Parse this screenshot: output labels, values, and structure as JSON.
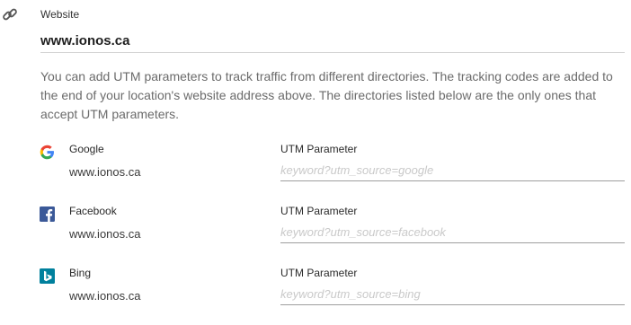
{
  "website": {
    "label": "Website",
    "value": "www.ionos.ca",
    "icon": "link-icon"
  },
  "help_text": "You can add UTM parameters to track traffic from different directories. The tracking codes are added to the end of your location's website address above. The directories listed below are the only ones that accept UTM parameters.",
  "directories": [
    {
      "name": "Google",
      "icon": "google-icon",
      "url": "www.ionos.ca",
      "utm_label": "UTM Parameter",
      "utm_value": "",
      "utm_placeholder": "keyword?utm_source=google"
    },
    {
      "name": "Facebook",
      "icon": "facebook-icon",
      "url": "www.ionos.ca",
      "utm_label": "UTM Parameter",
      "utm_value": "",
      "utm_placeholder": "keyword?utm_source=facebook"
    },
    {
      "name": "Bing",
      "icon": "bing-icon",
      "url": "www.ionos.ca",
      "utm_label": "UTM Parameter",
      "utm_value": "",
      "utm_placeholder": "keyword?utm_source=bing"
    }
  ],
  "colors": {
    "facebook": "#3b5998",
    "bing": "#00809d",
    "google_blue": "#4285f4",
    "google_red": "#ea4335",
    "google_yellow": "#fbbc05",
    "google_green": "#34a853"
  }
}
